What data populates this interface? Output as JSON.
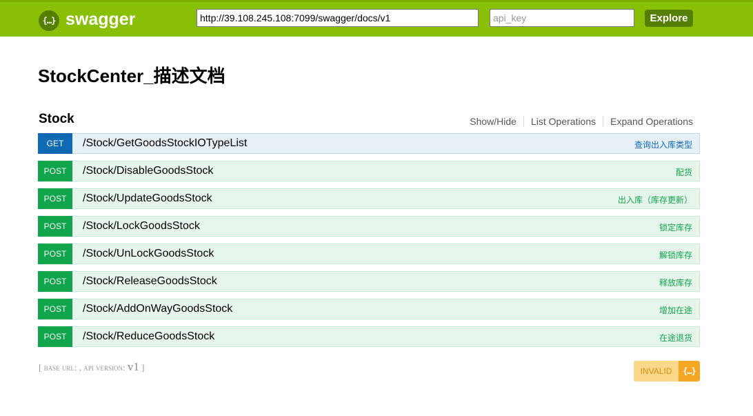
{
  "header": {
    "logo_glyph": "{…}",
    "logo_text": "swagger",
    "url_value": "http://39.108.245.108:7099/swagger/docs/v1",
    "api_key_placeholder": "api_key",
    "explore_label": "Explore",
    "bg_color": "#89bf04"
  },
  "page": {
    "title": "StockCenter_描述文档"
  },
  "resource": {
    "name": "Stock",
    "options": [
      "Show/Hide",
      "List Operations",
      "Expand Operations"
    ],
    "operations": [
      {
        "method": "GET",
        "path": "/Stock/GetGoodsStockIOTypeList",
        "summary": "查询出入库类型"
      },
      {
        "method": "POST",
        "path": "/Stock/DisableGoodsStock",
        "summary": "配货"
      },
      {
        "method": "POST",
        "path": "/Stock/UpdateGoodsStock",
        "summary": "出入库（库存更新）"
      },
      {
        "method": "POST",
        "path": "/Stock/LockGoodsStock",
        "summary": "锁定库存"
      },
      {
        "method": "POST",
        "path": "/Stock/UnLockGoodsStock",
        "summary": "解锁库存"
      },
      {
        "method": "POST",
        "path": "/Stock/ReleaseGoodsStock",
        "summary": "释放库存"
      },
      {
        "method": "POST",
        "path": "/Stock/AddOnWayGoodsStock",
        "summary": "增加在途"
      },
      {
        "method": "POST",
        "path": "/Stock/ReduceGoodsStock",
        "summary": "在途退货"
      }
    ]
  },
  "footer": {
    "open_bracket": "[",
    "base_url_label": "base url",
    "base_url_sep": ": ,",
    "api_version_label": "api version",
    "api_version_sep": ":",
    "api_version": "v1",
    "close_bracket": "]",
    "validator_text": "INVALID",
    "validator_icon": "{…}"
  },
  "colors": {
    "get": "#0f6ab4",
    "post": "#10a54a",
    "validator": "#f5a623"
  }
}
